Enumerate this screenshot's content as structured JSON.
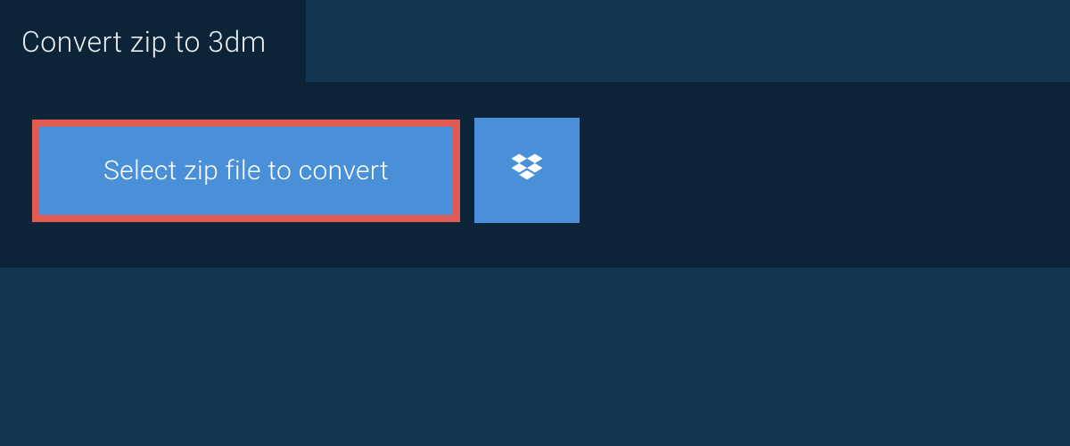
{
  "header": {
    "title": "Convert zip to 3dm"
  },
  "actions": {
    "select_file_label": "Select zip file to convert",
    "dropbox_icon": "dropbox-icon"
  },
  "colors": {
    "background": "#143651",
    "panel": "#0d2438",
    "button": "#4a90d9",
    "highlight_border": "#e05a52",
    "text_light": "#e8eef4",
    "text_white": "#ffffff"
  }
}
